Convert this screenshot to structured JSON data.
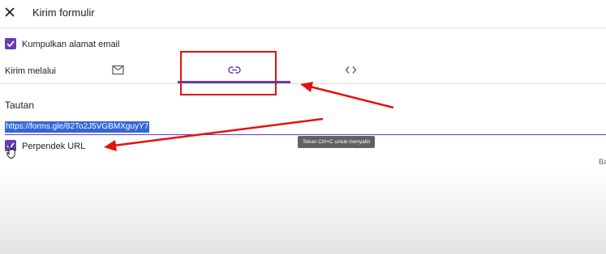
{
  "dialog": {
    "title": "Kirim formulir",
    "collect_email_label": "Kumpulkan alamat email",
    "collect_email_checked": true,
    "send_via_label": "Kirim melalui",
    "tabs": [
      {
        "icon": "mail-icon",
        "selected": false
      },
      {
        "icon": "link-icon",
        "selected": true
      },
      {
        "icon": "embed-code-icon",
        "selected": false
      }
    ],
    "link_section_title": "Tautan",
    "link_url": "https://forms.gle/82To2J5VGBMXguyY7",
    "copy_tooltip": "Tekan Ctrl+C untuk menyalin",
    "shorten_url_label": "Perpendek URL",
    "shorten_url_checked": true,
    "clipped_button_text": "Ba"
  },
  "colors": {
    "accent": "#673ab7",
    "annotation": "#e3120b",
    "selection": "#3367d6",
    "tooltip_bg": "#616161"
  }
}
